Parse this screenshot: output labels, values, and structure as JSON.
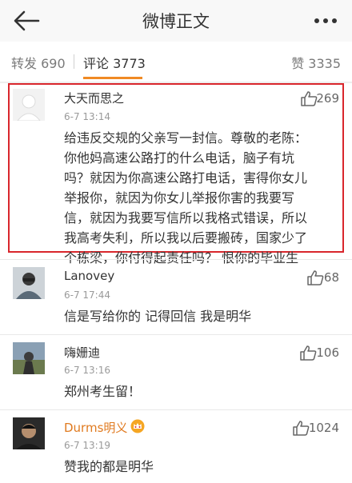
{
  "header": {
    "title": "微博正文",
    "back_icon": "back-arrow-icon",
    "more_icon": "more-dots-icon"
  },
  "tabs": {
    "repost": "转发 690",
    "comments": "评论 3773",
    "likes": "赞 3335"
  },
  "accent": "#f08a24",
  "highlight_color": "#d9262c",
  "comments": [
    {
      "user": "大天而思之",
      "time": "6-7 13:14",
      "likes": "269",
      "lines": [
        "给违反交规的父亲写一封信。尊敬的老陈：",
        "你他妈高速公路打的什么电话，脑子有坑",
        "吗？就因为你高速公路打电话，害得你女儿",
        "举报你，就因为你女儿举报你害的我要写",
        "信，就因为我要写信所以我格式错误，所以",
        "我高考失利，所以我以后要搬砖，国家少了",
        "个栋梁，你付得起责任吗？ 恨你的毕业生"
      ]
    },
    {
      "user": "Lanovey",
      "time": "6-7 17:44",
      "likes": "68",
      "text": "信是写给你的 记得回信 我是明华"
    },
    {
      "user": "嗨姗迪",
      "time": "6-7 13:16",
      "likes": "106",
      "text": "郑州考生留！"
    },
    {
      "user": "Durms明义",
      "time": "6-7 13:19",
      "likes": "1024",
      "text": "赞我的都是明华",
      "badge_icon": "vip-crown-icon"
    }
  ]
}
